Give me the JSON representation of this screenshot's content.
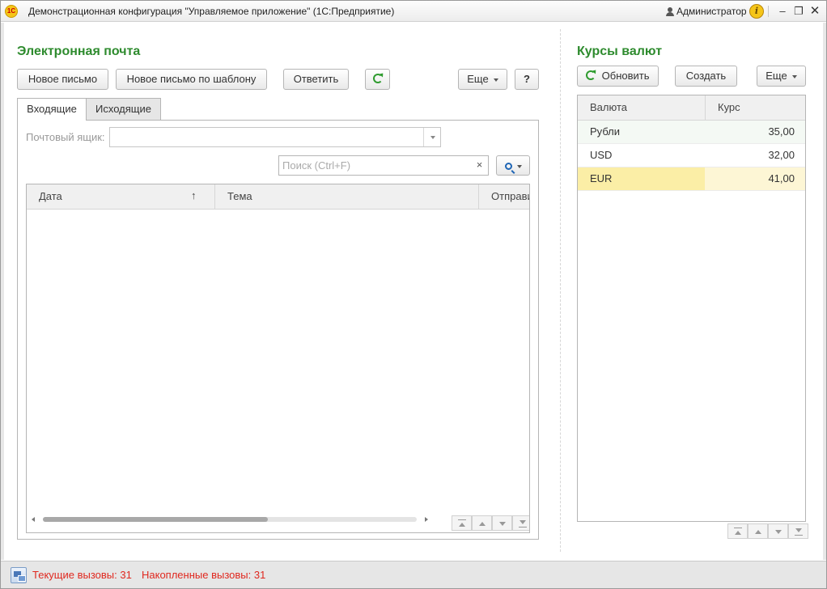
{
  "window": {
    "title": "Демонстрационная конфигурация \"Управляемое приложение\" (1С:Предприятие)",
    "user": "Администратор",
    "logo_text": "1С"
  },
  "mail": {
    "title": "Электронная почта",
    "buttons": {
      "new_letter": "Новое письмо",
      "new_by_template": "Новое письмо по шаблону",
      "reply": "Ответить",
      "more": "Еще",
      "help": "?"
    },
    "tabs": [
      {
        "label": "Входящие",
        "active": true
      },
      {
        "label": "Исходящие",
        "active": false
      }
    ],
    "mailbox_label": "Почтовый ящик:",
    "mailbox_value": "",
    "search": {
      "placeholder": "Поиск (Ctrl+F)",
      "value": "",
      "clear": "×"
    },
    "columns": [
      {
        "label": "Дата",
        "sort": "↑"
      },
      {
        "label": "Тема"
      },
      {
        "label": "Отправитель"
      }
    ],
    "rows": []
  },
  "currency": {
    "title": "Курсы валют",
    "buttons": {
      "refresh": "Обновить",
      "create": "Создать",
      "more": "Еще"
    },
    "columns": [
      "Валюта",
      "Курс"
    ],
    "rows": [
      {
        "currency": "Рубли",
        "rate": "35,00"
      },
      {
        "currency": "USD",
        "rate": "32,00"
      },
      {
        "currency": "EUR",
        "rate": "41,00"
      }
    ],
    "selected_row": 2
  },
  "status": {
    "current_calls": "Текущие вызовы: 31",
    "accumulated_calls": "Накопленные вызовы: 31"
  },
  "colors": {
    "section_title": "#2e8b2e",
    "selected_row": "#fbeea6",
    "selected_row_light": "#fdf6d5",
    "status_text": "#e0281f"
  }
}
